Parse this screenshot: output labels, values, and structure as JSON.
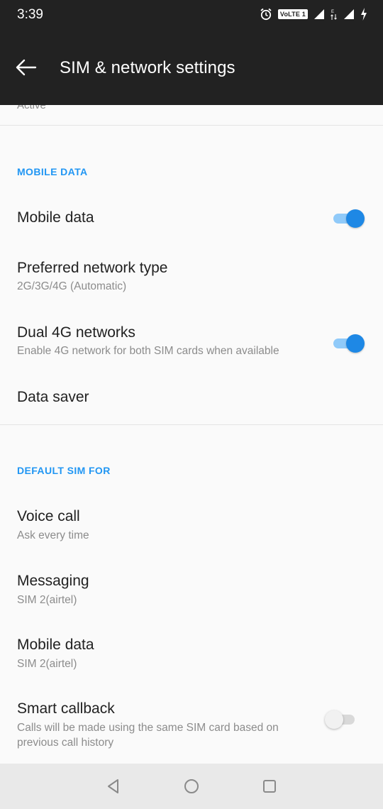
{
  "status_bar": {
    "time": "3:39",
    "volte_label": "VoLTE 1",
    "network_badge": "E",
    "icons": [
      "alarm-icon",
      "signal-icon",
      "data-arrows-icon",
      "signal-icon",
      "charging-icon"
    ]
  },
  "app_bar": {
    "title": "SIM & network settings",
    "back_icon": "arrow-left-icon"
  },
  "content": {
    "clipped_text": "Active",
    "sections": [
      {
        "header": "MOBILE DATA",
        "items": [
          {
            "title": "Mobile data",
            "toggle": true
          },
          {
            "title": "Preferred network type",
            "subtitle": "2G/3G/4G (Automatic)"
          },
          {
            "title": "Dual 4G networks",
            "subtitle": "Enable 4G network for both SIM cards when available",
            "toggle": true
          },
          {
            "title": "Data saver"
          }
        ]
      },
      {
        "header": "DEFAULT SIM FOR",
        "items": [
          {
            "title": "Voice call",
            "subtitle": "Ask every time"
          },
          {
            "title": "Messaging",
            "subtitle": "SIM 2(airtel)"
          },
          {
            "title": "Mobile data",
            "subtitle": "SIM 2(airtel)"
          },
          {
            "title": "Smart callback",
            "subtitle_line1": "Calls will be made using the same SIM card based on",
            "subtitle_line2": "previous call history",
            "toggle": false
          }
        ]
      }
    ]
  },
  "colors": {
    "accent": "#2196f3",
    "toggle_on": "#1e88e5",
    "app_bar_bg": "#222222",
    "background": "#fafafa"
  },
  "nav_bar": {
    "buttons": [
      "back-triangle-icon",
      "home-circle-icon",
      "recents-square-icon"
    ]
  }
}
